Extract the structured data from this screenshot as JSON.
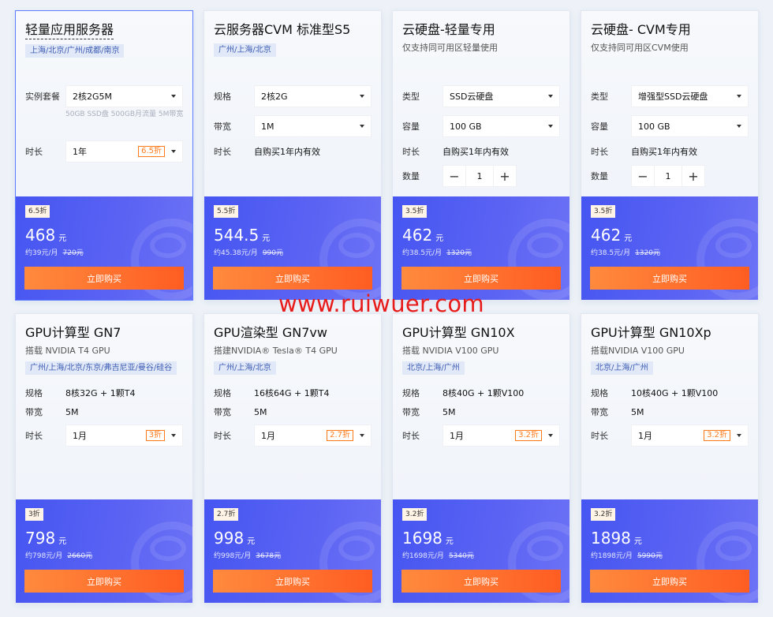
{
  "cards": [
    {
      "title": "轻量应用服务器",
      "subtitle": "",
      "region": "上海/北京/广州/成都/南京",
      "fields": [
        {
          "label": "实例套餐",
          "type": "select",
          "value": "2核2G5M",
          "discount": ""
        },
        {
          "label": "",
          "type": "note",
          "value": "50GB SSD盘 500GB月流量 5M带宽"
        },
        {
          "label": "时长",
          "type": "select",
          "value": "1年",
          "discount": "6.5折"
        }
      ],
      "badge": "6.5折",
      "price": "468",
      "unit": "元",
      "per_month": "约39元/月",
      "original": "720元",
      "buy": "立即购买"
    },
    {
      "title": "云服务器CVM 标准型S5",
      "subtitle": "",
      "region": "广州/上海/北京",
      "fields": [
        {
          "label": "规格",
          "type": "select",
          "value": "2核2G",
          "discount": ""
        },
        {
          "label": "带宽",
          "type": "select",
          "value": "1M",
          "discount": ""
        },
        {
          "label": "时长",
          "type": "text",
          "value": "自购买1年内有效"
        }
      ],
      "badge": "5.5折",
      "price": "544.5",
      "unit": "元",
      "per_month": "约45.38元/月",
      "original": "990元",
      "buy": "立即购买"
    },
    {
      "title": "云硬盘-轻量专用",
      "subtitle": "仅支持同可用区轻量使用",
      "region": "",
      "fields": [
        {
          "label": "类型",
          "type": "select",
          "value": "SSD云硬盘",
          "discount": ""
        },
        {
          "label": "容量",
          "type": "select",
          "value": "100 GB",
          "discount": ""
        },
        {
          "label": "时长",
          "type": "text",
          "value": "自购买1年内有效"
        },
        {
          "label": "数量",
          "type": "stepper",
          "value": "1",
          "minus": "−",
          "plus": "+"
        }
      ],
      "badge": "3.5折",
      "price": "462",
      "unit": "元",
      "per_month": "约38.5元/月",
      "original": "1320元",
      "buy": "立即购买"
    },
    {
      "title": "云硬盘- CVM专用",
      "subtitle": "仅支持同可用区CVM使用",
      "region": "",
      "fields": [
        {
          "label": "类型",
          "type": "select",
          "value": "增强型SSD云硬盘",
          "discount": ""
        },
        {
          "label": "容量",
          "type": "select",
          "value": "100 GB",
          "discount": ""
        },
        {
          "label": "时长",
          "type": "text",
          "value": "自购买1年内有效"
        },
        {
          "label": "数量",
          "type": "stepper",
          "value": "1",
          "minus": "−",
          "plus": "+"
        }
      ],
      "badge": "3.5折",
      "price": "462",
      "unit": "元",
      "per_month": "约38.5元/月",
      "original": "1320元",
      "buy": "立即购买"
    },
    {
      "title": "GPU计算型 GN7",
      "subtitle": "搭载 NVIDIA T4 GPU",
      "region": "广州/上海/北京/东京/弗吉尼亚/曼谷/硅谷",
      "fields": [
        {
          "label": "规格",
          "type": "text",
          "value": "8核32G + 1颗T4"
        },
        {
          "label": "带宽",
          "type": "text",
          "value": "5M"
        },
        {
          "label": "时长",
          "type": "select",
          "value": "1月",
          "discount": "3折"
        }
      ],
      "badge": "3折",
      "price": "798",
      "unit": "元",
      "per_month": "约798元/月",
      "original": "2660元",
      "buy": "立即购买"
    },
    {
      "title": "GPU渲染型 GN7vw",
      "subtitle": "搭建NVIDIA® Tesla® T4 GPU",
      "region": "广州/上海/北京",
      "fields": [
        {
          "label": "规格",
          "type": "text",
          "value": "16核64G + 1颗T4"
        },
        {
          "label": "带宽",
          "type": "text",
          "value": "5M"
        },
        {
          "label": "时长",
          "type": "select",
          "value": "1月",
          "discount": "2.7折"
        }
      ],
      "badge": "2.7折",
      "price": "998",
      "unit": "元",
      "per_month": "约998元/月",
      "original": "3678元",
      "buy": "立即购买"
    },
    {
      "title": "GPU计算型 GN10X",
      "subtitle": "搭载 NVIDIA V100 GPU",
      "region": "北京/上海/广州",
      "fields": [
        {
          "label": "规格",
          "type": "text",
          "value": "8核40G + 1颗V100"
        },
        {
          "label": "带宽",
          "type": "text",
          "value": "5M"
        },
        {
          "label": "时长",
          "type": "select",
          "value": "1月",
          "discount": "3.2折"
        }
      ],
      "badge": "3.2折",
      "price": "1698",
      "unit": "元",
      "per_month": "约1698元/月",
      "original": "5340元",
      "buy": "立即购买"
    },
    {
      "title": "GPU计算型 GN10Xp",
      "subtitle": "搭载NVIDIA V100 GPU",
      "region": "北京/上海/广州",
      "fields": [
        {
          "label": "规格",
          "type": "text",
          "value": "10核40G + 1颗V100"
        },
        {
          "label": "带宽",
          "type": "text",
          "value": "5M"
        },
        {
          "label": "时长",
          "type": "select",
          "value": "1月",
          "discount": "3.2折"
        }
      ],
      "badge": "3.2折",
      "price": "1898",
      "unit": "元",
      "per_month": "约1898元/月",
      "original": "5990元",
      "buy": "立即购买"
    }
  ],
  "watermark": "www.ruiwuer.com"
}
